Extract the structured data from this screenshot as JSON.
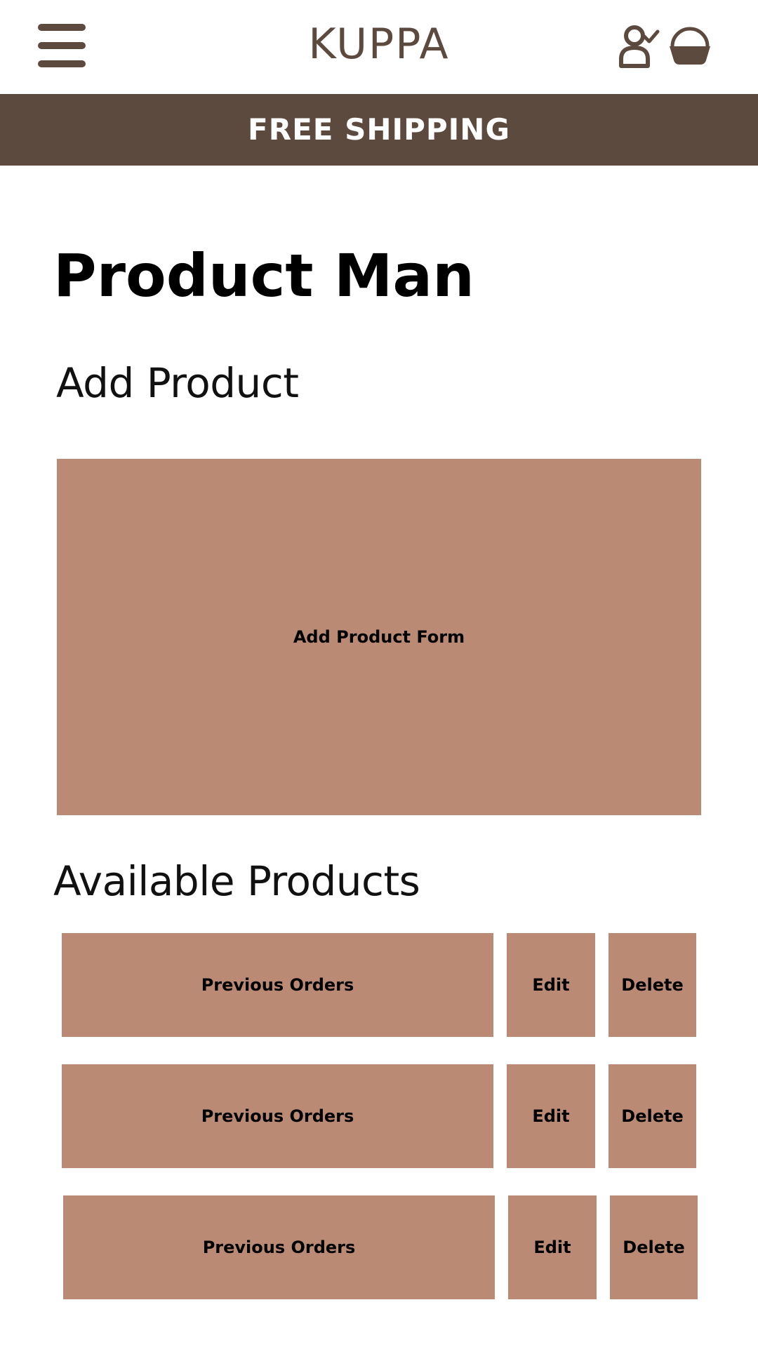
{
  "header": {
    "logo_text": "KUPPA",
    "menu_icon": "hamburger-menu-icon",
    "account_icon": "user-check-icon",
    "cart_icon": "basket-icon",
    "brand_color": "#5d4a3f"
  },
  "banner": {
    "text": "FREE SHIPPING"
  },
  "page": {
    "title": "Product Man"
  },
  "add_product": {
    "heading": "Add Product",
    "form_label": "Add Product Form",
    "panel_color": "#bb8a74"
  },
  "available_products": {
    "heading": "Available Products",
    "rows": [
      {
        "orders_label": "Previous Orders",
        "edit_label": "Edit",
        "delete_label": "Delete"
      },
      {
        "orders_label": "Previous Orders",
        "edit_label": "Edit",
        "delete_label": "Delete"
      },
      {
        "orders_label": "Previous Orders",
        "edit_label": "Edit",
        "delete_label": "Delete"
      }
    ]
  }
}
